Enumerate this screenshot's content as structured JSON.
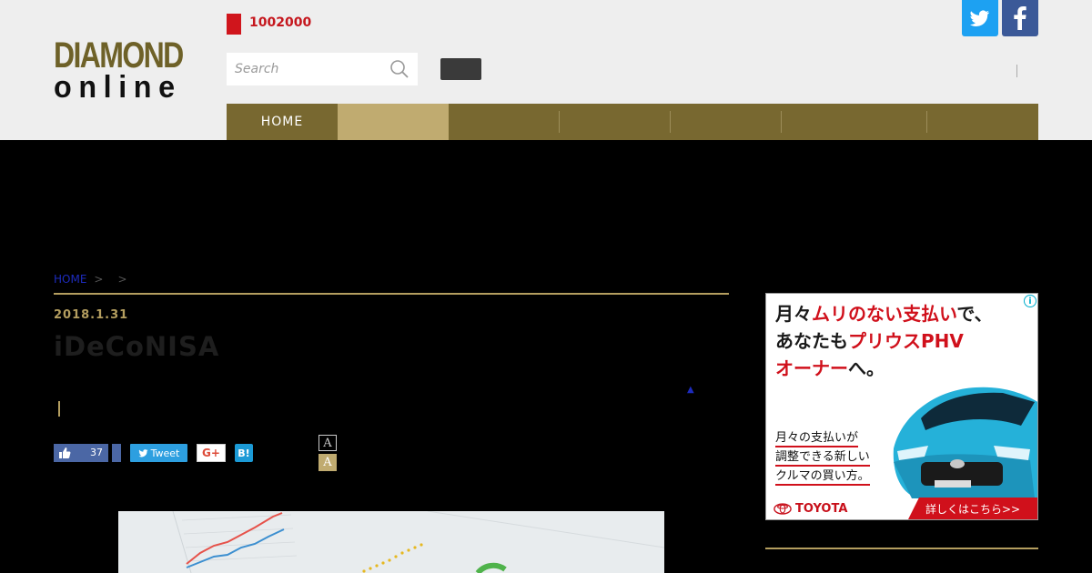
{
  "header": {
    "logo_top": "DIAMOND",
    "logo_bottom": "online",
    "count": "1002000",
    "search_placeholder": "Search"
  },
  "nav": {
    "items": [
      {
        "label": "HOME",
        "active": false
      },
      {
        "label": "",
        "active": true
      },
      {
        "label": "",
        "active": false
      },
      {
        "label": "",
        "active": false
      },
      {
        "label": "",
        "active": false
      },
      {
        "label": "",
        "active": false
      },
      {
        "label": "",
        "active": false
      }
    ]
  },
  "breadcrumb": {
    "home": "HOME",
    "sep1": ">",
    "sep2": ">"
  },
  "article": {
    "date": "2018.1.31",
    "title": "iDeCoNISA",
    "tri": "▲"
  },
  "share": {
    "like_count": "37",
    "tweet_label": "Tweet",
    "gplus_label": "G+",
    "hatena_label": "B!",
    "font_small": "A",
    "font_large": "A"
  },
  "ad": {
    "line1_a": "月々",
    "line1_b": "ムリのない支払い",
    "line1_c": "で、",
    "line2_a": "あなたも",
    "line2_b": "プリウスPHV",
    "line3_a": "オーナー",
    "line3_b": "へ。",
    "sub1": "月々の支払いが",
    "sub2": "調整できる新しい",
    "sub3": "クルマの買い方。",
    "brand": "TOYOTA",
    "cta": "詳しくはこちら>>",
    "info": "i"
  }
}
